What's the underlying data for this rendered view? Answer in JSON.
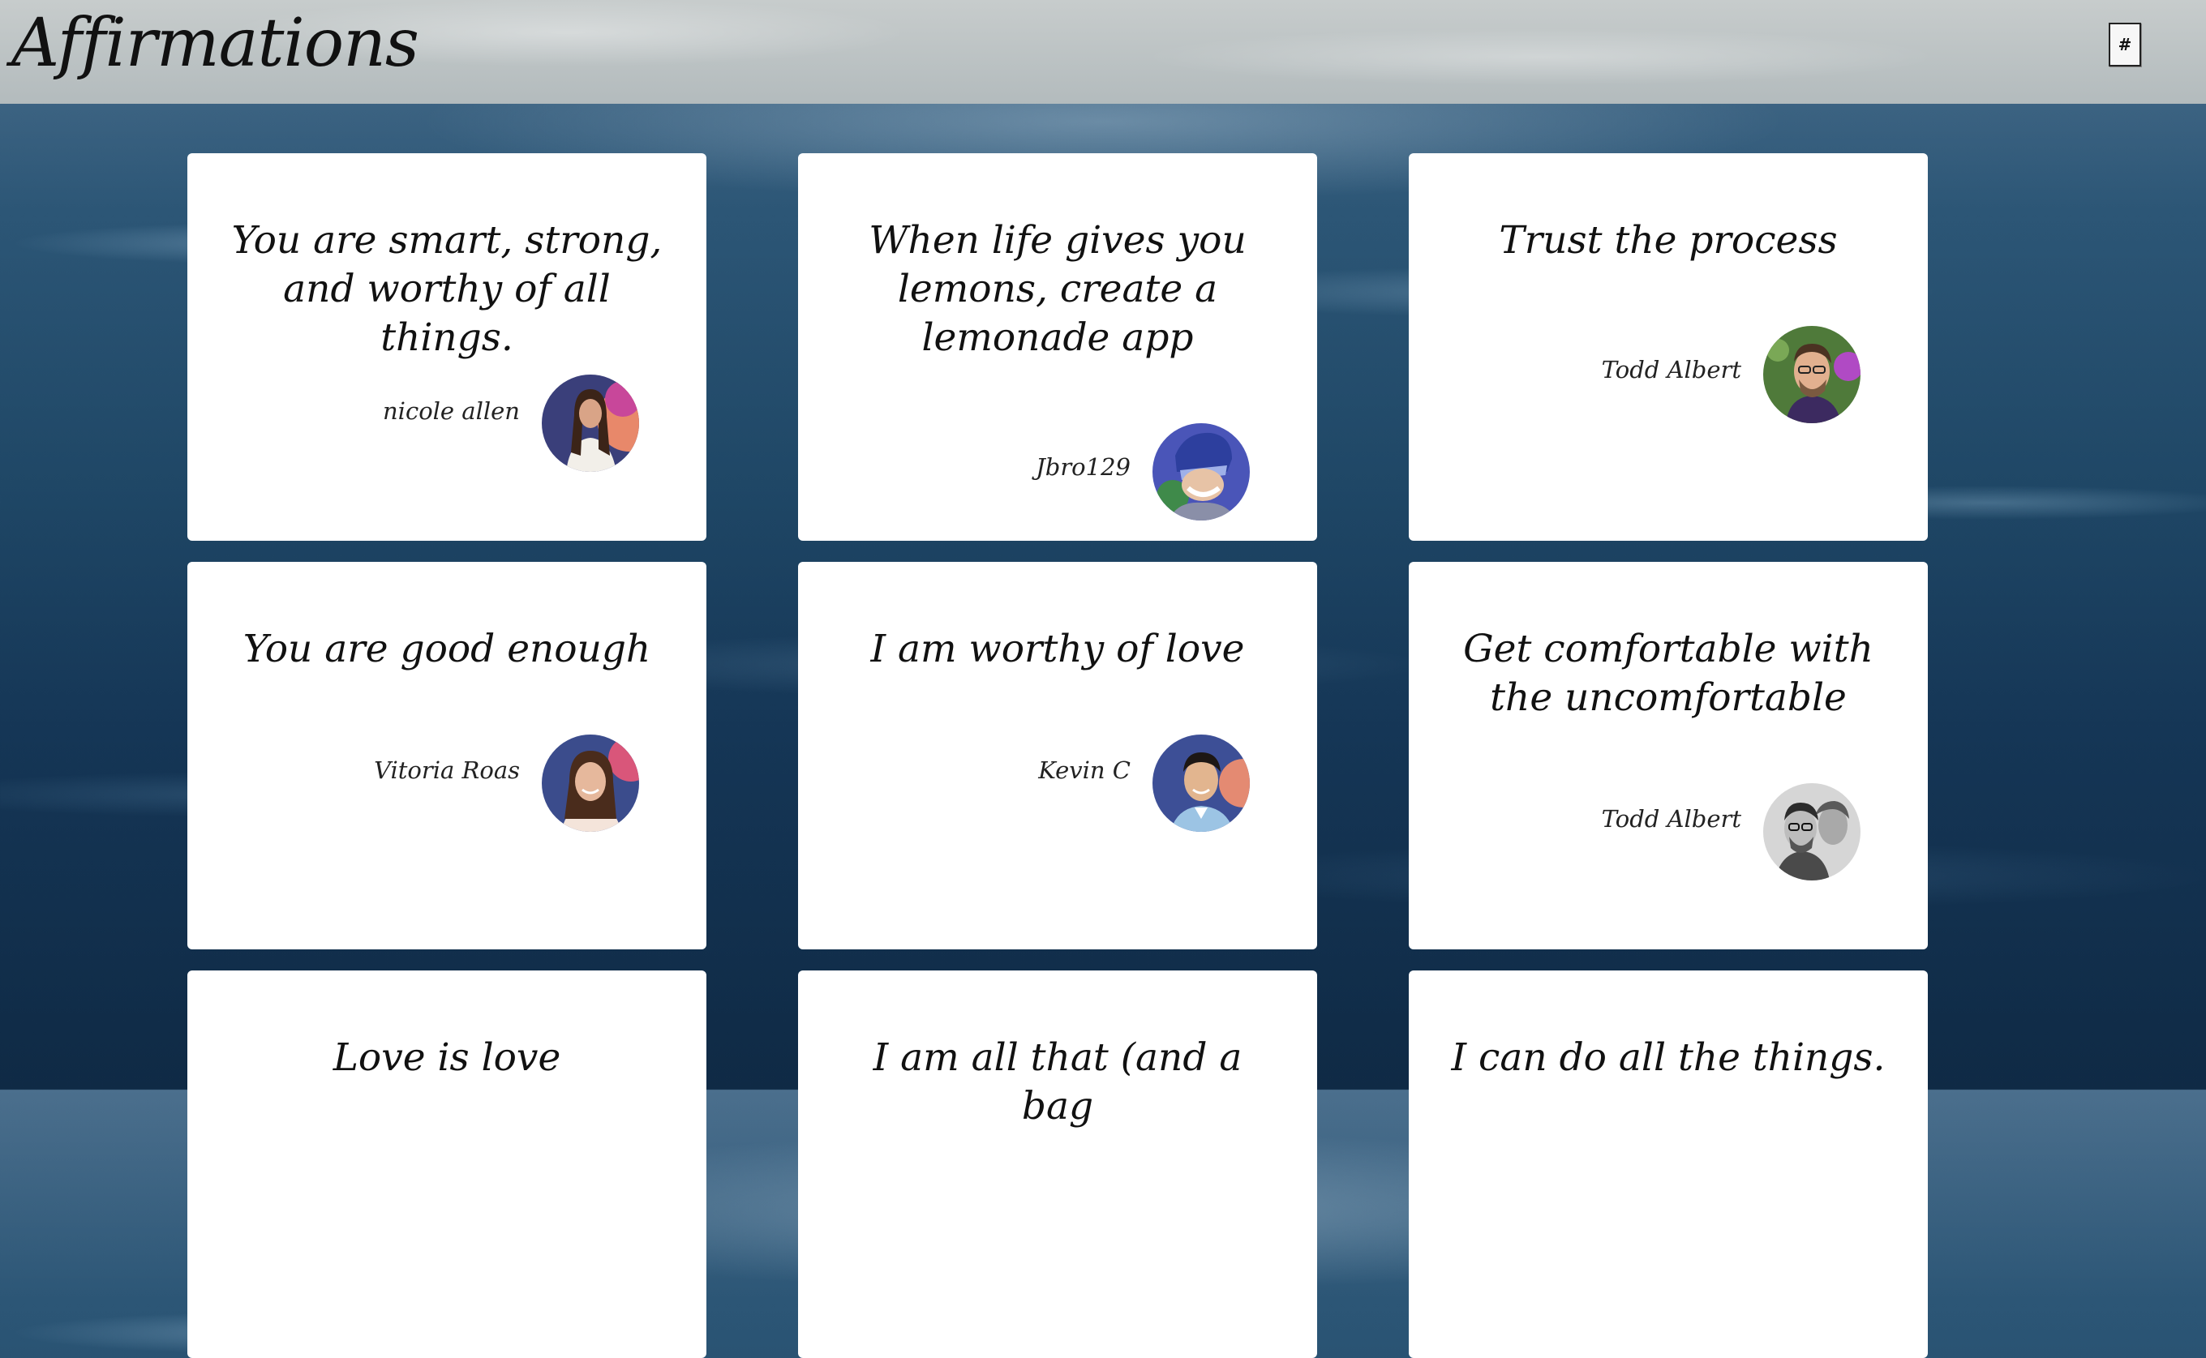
{
  "header": {
    "title": "Affirmations",
    "menu_button": "#"
  },
  "cards": [
    {
      "quote": "You are smart, strong, and worthy of all things.",
      "author": "nicole allen"
    },
    {
      "quote": "When life gives you lemons, create a lemonade app",
      "author": "Jbro129"
    },
    {
      "quote": "Trust the process",
      "author": "Todd Albert"
    },
    {
      "quote": "You are good enough",
      "author": "Vitoria Roas"
    },
    {
      "quote": "I am worthy of love",
      "author": "Kevin C"
    },
    {
      "quote": "Get comfortable with the uncomfortable",
      "author": "Todd Albert"
    },
    {
      "quote": "Love is love"
    },
    {
      "quote": "I am all that (and a bag"
    },
    {
      "quote": "I can do all the things."
    }
  ]
}
